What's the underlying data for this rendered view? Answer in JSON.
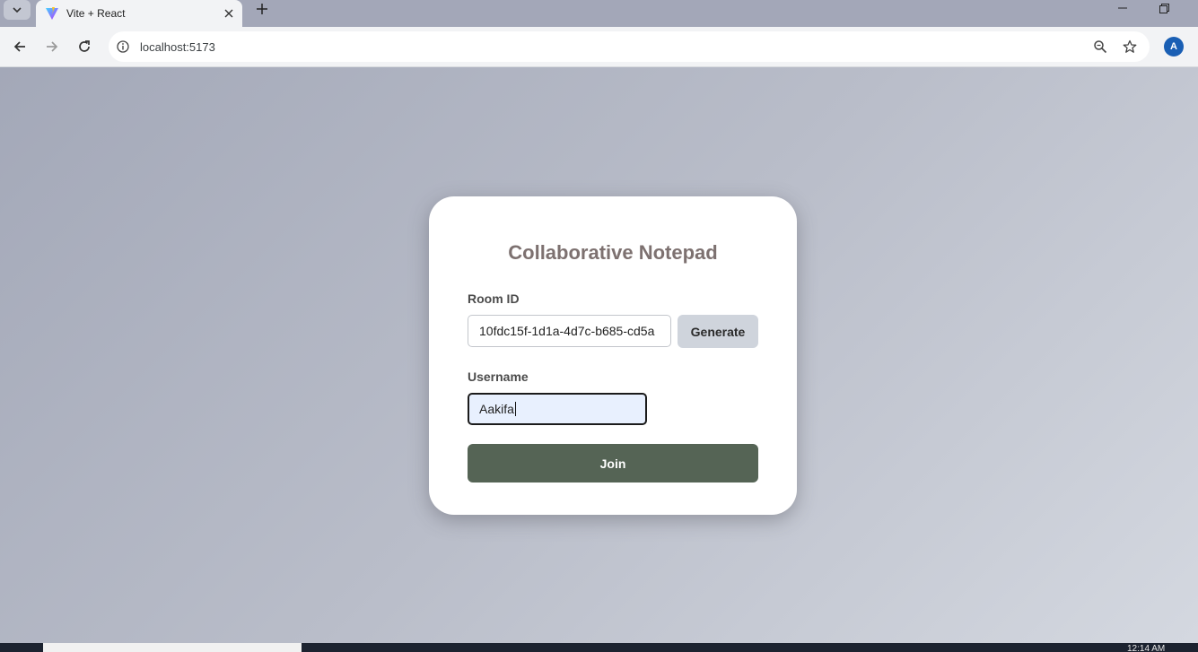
{
  "browser": {
    "tab": {
      "title": "Vite + React",
      "favicon": "vite-logo-icon"
    },
    "toolbar": {
      "back_icon": "back-arrow-icon",
      "forward_icon": "forward-arrow-icon",
      "reload_icon": "reload-icon",
      "url": "localhost:5173",
      "profile_initial": "A"
    },
    "accent_color": "#1a5fb4"
  },
  "card": {
    "title": "Collaborative Notepad",
    "room_label": "Room ID",
    "room_value": "10fdc15f-1d1a-4d7c-b685-cd5a",
    "generate_label": "Generate",
    "username_label": "Username",
    "username_value": "Aakifa",
    "join_label": "Join",
    "join_color": "#556455",
    "title_color": "#7d7170"
  },
  "taskbar": {
    "clock": "12:14 AM"
  }
}
